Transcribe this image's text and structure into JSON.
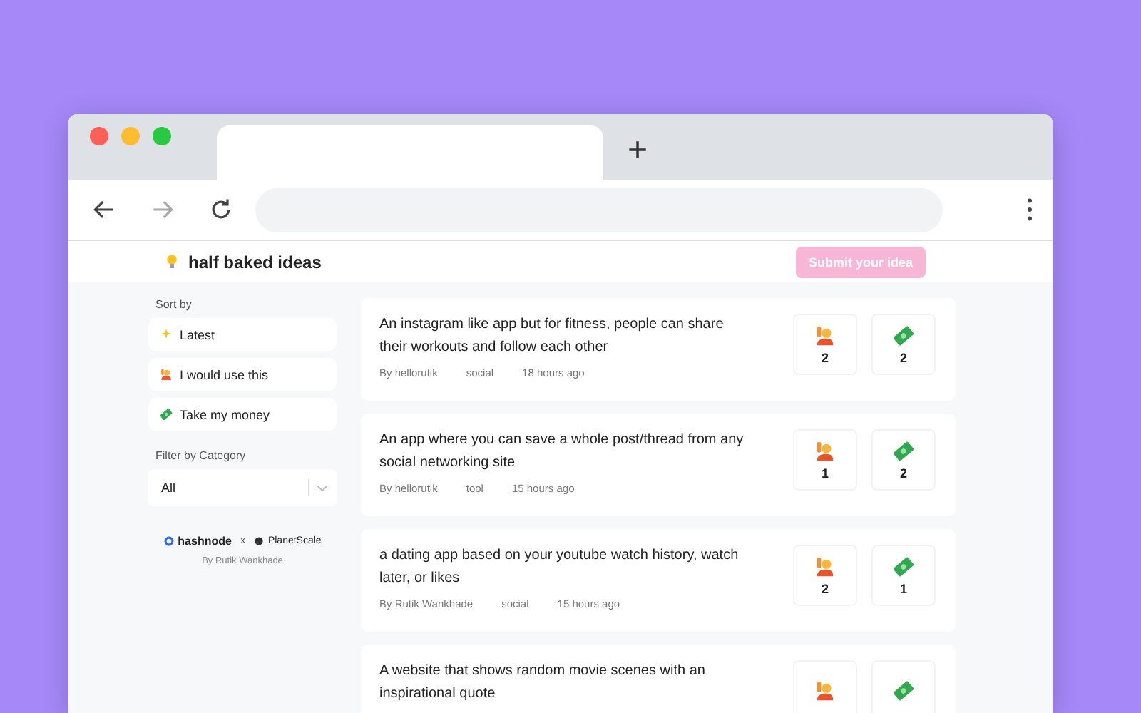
{
  "browser": {
    "new_tab_symbol": "+"
  },
  "header": {
    "title": "half baked ideas",
    "submit_button": "Submit your idea"
  },
  "sidebar": {
    "sort_label": "Sort by",
    "sort_options": [
      {
        "label": "Latest",
        "kind": "sparkle",
        "selected": false
      },
      {
        "label": "I would use this",
        "kind": "hand",
        "selected": false
      },
      {
        "label": "Take my money",
        "kind": "money",
        "selected": false
      }
    ],
    "filter_label": "Filter by Category",
    "filter_value": "All",
    "partners": {
      "first": "hashnode",
      "separator": "x",
      "second": "PlanetScale"
    },
    "credit": "By Rutik Wankhade"
  },
  "ideas": [
    {
      "title": "An instagram like app but for fitness, people can share their workouts and follow each other",
      "author": "By hellorutik",
      "category": "social",
      "time": "18 hours ago",
      "use_count": "2",
      "money_count": "2"
    },
    {
      "title": "An app where you can save a whole post/thread from any social networking site",
      "author": "By hellorutik",
      "category": "tool",
      "time": "15 hours ago",
      "use_count": "1",
      "money_count": "2"
    },
    {
      "title": "a dating app based on your youtube watch history, watch later, or likes",
      "author": "By Rutik Wankhade",
      "category": "social",
      "time": "15 hours ago",
      "use_count": "2",
      "money_count": "1"
    },
    {
      "title": "A website that shows random movie scenes with an inspirational quote"
    }
  ]
}
